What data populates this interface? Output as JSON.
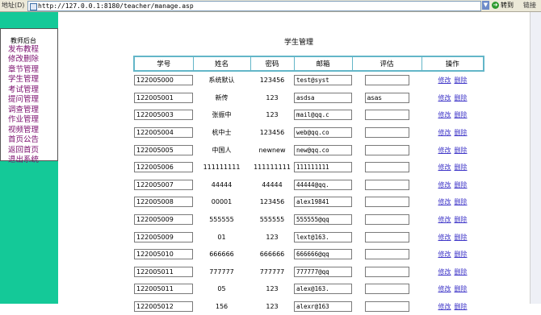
{
  "browser": {
    "address_label": "地址(D)",
    "url": "http://127.0.0.1:8180/teacher/manage.asp",
    "go_label": "转到",
    "links_label": "链接"
  },
  "sidebar": {
    "title": "教师后台",
    "items": [
      {
        "label": "发布教程"
      },
      {
        "label": "修改删除"
      },
      {
        "label": "章节管理"
      },
      {
        "label": "学生管理"
      },
      {
        "label": "考试管理"
      },
      {
        "label": "提问管理"
      },
      {
        "label": "调查管理"
      },
      {
        "label": "作业管理"
      },
      {
        "label": "视频管理"
      },
      {
        "label": "首页公告"
      },
      {
        "label": "返回首页"
      },
      {
        "label": "退出系统"
      }
    ]
  },
  "main": {
    "title": "学生管理",
    "columns": [
      "学号",
      "姓名",
      "密码",
      "邮箱",
      "评估",
      "操作"
    ],
    "edit_label": "修改",
    "delete_label": "删除",
    "rows": [
      {
        "id": "122005000",
        "name": "系统默认",
        "password": "123456",
        "email": "test@syst",
        "eval": ""
      },
      {
        "id": "122005001",
        "name": "新传",
        "password": "123",
        "email": "asdsa",
        "eval": "asas"
      },
      {
        "id": "122005003",
        "name": "张振中",
        "password": "123",
        "email": "mail@qq.c",
        "eval": ""
      },
      {
        "id": "122005004",
        "name": "杭中士",
        "password": "123456",
        "email": "web@qq.co",
        "eval": ""
      },
      {
        "id": "122005005",
        "name": "中国人",
        "password": "newnew",
        "email": "new@qq.co",
        "eval": ""
      },
      {
        "id": "122005006",
        "name": "111111111",
        "password": "111111111",
        "email": "111111111",
        "eval": ""
      },
      {
        "id": "122005007",
        "name": "44444",
        "password": "44444",
        "email": "44444@qq.",
        "eval": ""
      },
      {
        "id": "122005008",
        "name": "00001",
        "password": "123456",
        "email": "alex19841",
        "eval": ""
      },
      {
        "id": "122005009",
        "name": "555555",
        "password": "555555",
        "email": "555555@qq",
        "eval": ""
      },
      {
        "id": "122005009",
        "name": "01",
        "password": "123",
        "email": "lext@163.",
        "eval": ""
      },
      {
        "id": "122005010",
        "name": "666666",
        "password": "666666",
        "email": "666666@qq",
        "eval": ""
      },
      {
        "id": "122005011",
        "name": "777777",
        "password": "777777",
        "email": "777777@qq",
        "eval": ""
      },
      {
        "id": "122005011",
        "name": "05",
        "password": "123",
        "email": "alex@163.",
        "eval": ""
      },
      {
        "id": "122005012",
        "name": "156",
        "password": "123",
        "email": "alexr@163",
        "eval": ""
      }
    ]
  }
}
